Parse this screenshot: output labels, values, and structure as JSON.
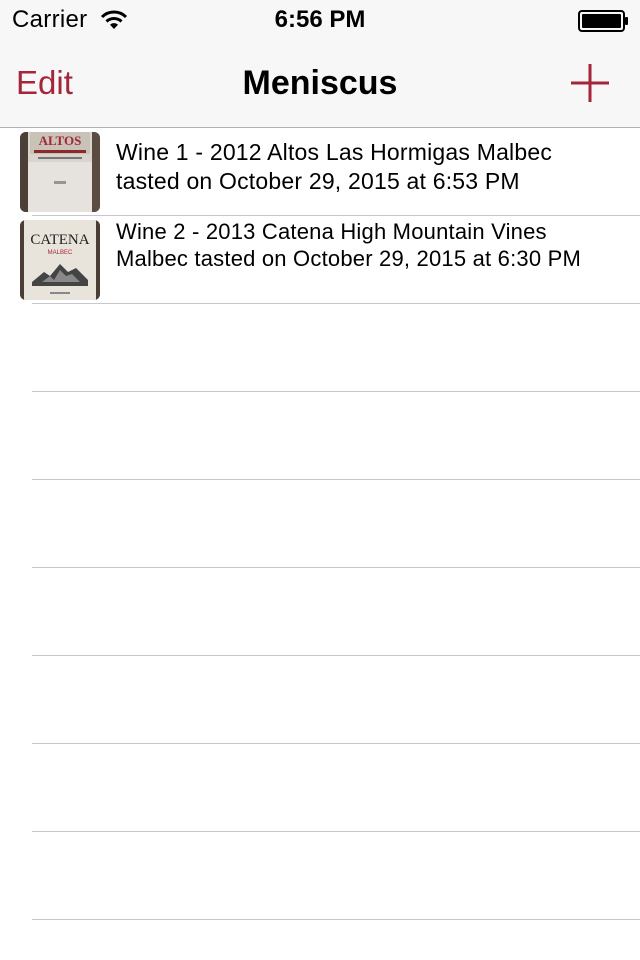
{
  "status_bar": {
    "carrier": "Carrier",
    "time": "6:56 PM",
    "icons": [
      "wifi-icon",
      "battery-icon"
    ]
  },
  "nav": {
    "edit_label": "Edit",
    "title": "Meniscus",
    "add_icon": "plus-icon",
    "accent_color": "#a3263a"
  },
  "wines": [
    {
      "text": "Wine 1 - 2012 Altos Las Hormigas Malbec tasted on October 29, 2015 at 6:53 PM",
      "thumb_label": "ALTOS"
    },
    {
      "text": "Wine 2 - 2013 Catena High Mountain Vines Malbec tasted on October 29, 2015 at 6:30 PM",
      "thumb_label": "CATENA",
      "thumb_sublabel": "MALBEC"
    }
  ]
}
